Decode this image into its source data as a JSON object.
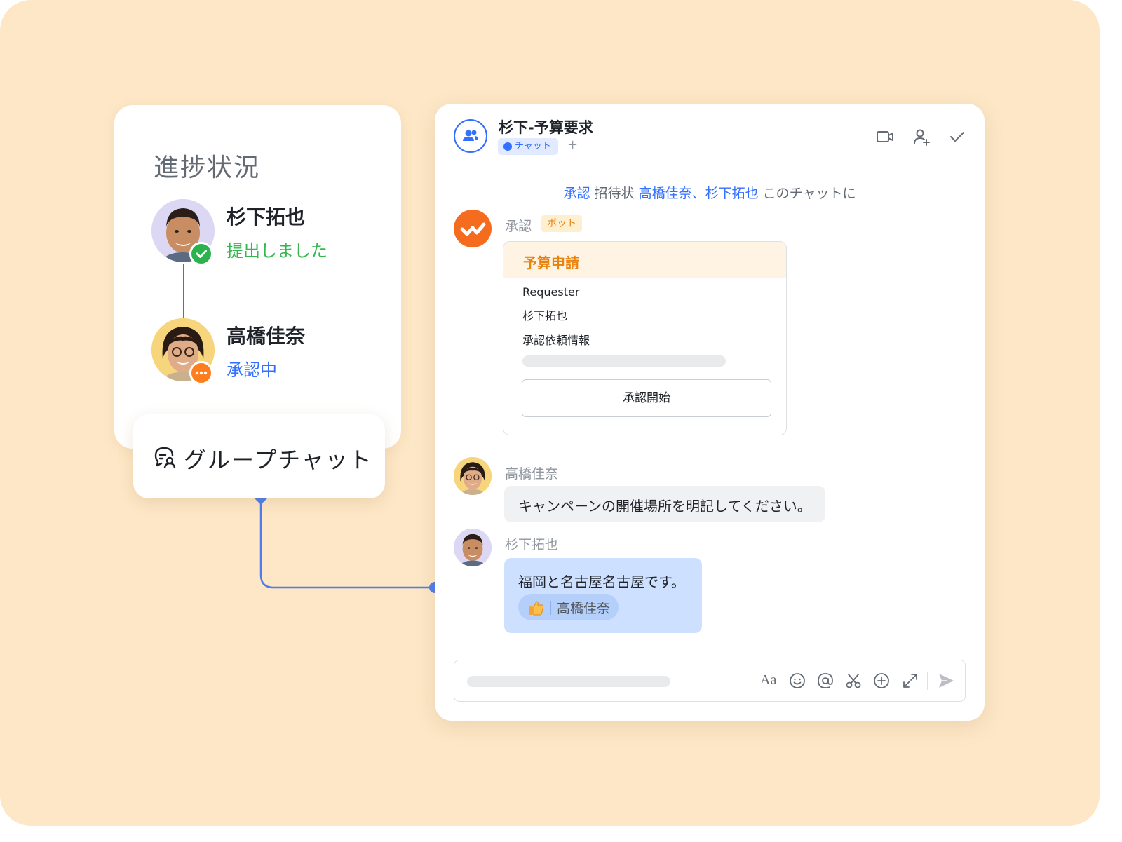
{
  "progress": {
    "title": "進捗状況",
    "people": [
      {
        "name": "杉下拓也",
        "status": "提出しました",
        "status_color": "#34b84d"
      },
      {
        "name": "高橋佳奈",
        "status": "承認中",
        "status_color": "#3370ff"
      }
    ]
  },
  "group_chat": {
    "label": "グループチャット"
  },
  "chat": {
    "title": "杉下-予算要求",
    "tag": "チャット",
    "plus": "+",
    "system_message": {
      "link1": "承認",
      "text1": " 招待状 ",
      "link2": "高橋佳奈、杉下拓也",
      "text2": " このチャットに"
    },
    "bot": {
      "name": "承認",
      "tag": "ボット",
      "card": {
        "title": "予算申請",
        "requester_label": "Requester",
        "requester": "杉下拓也",
        "info_label": "承認依頼情報",
        "button": "承認開始"
      }
    },
    "messages": [
      {
        "sender": "高橋佳奈",
        "text": "キャンペーンの開催場所を明記してください。"
      },
      {
        "sender": "杉下拓也",
        "text": "福岡と名古屋名古屋です。",
        "reaction_by": "高橋佳奈"
      }
    ],
    "toolbar": {
      "font_label": "Aa"
    }
  },
  "colors": {
    "background": "#fde7c6",
    "accent_blue": "#3370ff",
    "accent_orange": "#ff7d1a",
    "success_green": "#34b84d"
  }
}
